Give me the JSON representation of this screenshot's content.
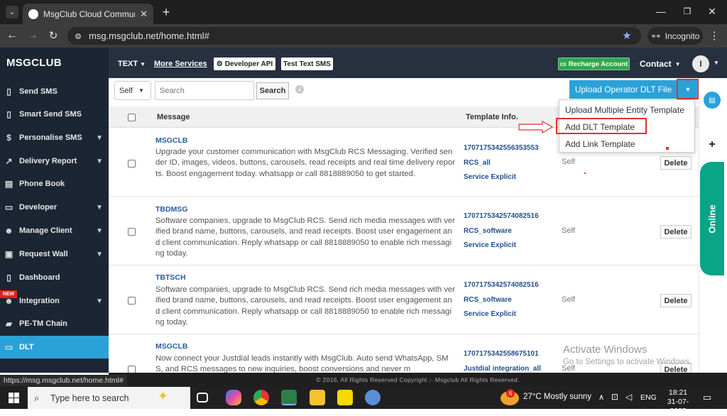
{
  "browser": {
    "tab_title": "MsgClub Cloud Communicatio",
    "url": "msg.msgclub.net/home.html#",
    "incognito_label": "Incognito",
    "status_url": "https://msg.msgclub.net/home.html#"
  },
  "header": {
    "brand": "MSGCLUB",
    "text_menu": "TEXT",
    "more_services": "More Services",
    "developer_api": "Developer API",
    "test_text_sms": "Test Text SMS",
    "recharge": "Recharge Account",
    "contact": "Contact",
    "avatar_initial": "I"
  },
  "sidebar": {
    "items": [
      {
        "label": "Send SMS",
        "icon": "phone-icon"
      },
      {
        "label": "Smart Send SMS",
        "icon": "phone-icon"
      },
      {
        "label": "Personalise SMS",
        "icon": "dollar-icon"
      },
      {
        "label": "Delivery Report",
        "icon": "chart-icon"
      },
      {
        "label": "Phone Book",
        "icon": "book-icon"
      },
      {
        "label": "Developer",
        "icon": "monitor-icon"
      },
      {
        "label": "Manage Client",
        "icon": "users-icon"
      },
      {
        "label": "Request Wall",
        "icon": "wall-icon"
      },
      {
        "label": "Dashboard",
        "icon": "file-icon"
      },
      {
        "label": "Integration",
        "icon": "users-icon"
      },
      {
        "label": "PE-TM Chain",
        "icon": "image-icon"
      },
      {
        "label": "DLT",
        "icon": "card-icon"
      }
    ],
    "new_badge": "NEW"
  },
  "toolbar": {
    "filter_value": "Self",
    "search_placeholder": "Search",
    "search_button": "Search",
    "upload_button": "Upload Operator DLT File"
  },
  "dropdown": {
    "items": [
      "Upload Multiple Entity Template",
      "Add DLT Template",
      "Add Link Template"
    ]
  },
  "table": {
    "headers": {
      "message": "Message",
      "template_info": "Template Info."
    },
    "rows": [
      {
        "sender": "MSGCLB",
        "message": "Upgrade your customer communication with MsgClub RCS Messaging. Verified sender ID, images, videos, buttons, carousels, read receipts and real time delivery reports. Boost engagement today. whatsapp or call 8818889050 to get started.",
        "template_id": "1707175342556353553",
        "template_name": "RCS_all",
        "category": "Service Explicit",
        "type": "Self",
        "delete": "Delete"
      },
      {
        "sender": "TBDMSG",
        "message": "Software companies, upgrade to MsgClub RCS. Send rich media messages with verified brand name, buttons, carousels, and read receipts. Boost user engagement and client communication. Reply whatsapp or call 8818889050 to enable rich messaging today.",
        "template_id": "1707175342574082516",
        "template_name": "RCS_software",
        "category": "Service Explicit",
        "type": "Self",
        "delete": "Delete"
      },
      {
        "sender": "TBTSCH",
        "message": "Software companies, upgrade to MsgClub RCS. Send rich media messages with verified brand name, buttons, carousels, and read receipts. Boost user engagement and client communication. Reply whatsapp or call 8818889050 to enable rich messaging today.",
        "template_id": "1707175342574082516",
        "template_name": "RCS_software",
        "category": "Service Explicit",
        "type": "Self",
        "delete": "Delete"
      },
      {
        "sender": "MSGCLB",
        "message": "Now connect your Justdial leads instantly with MsgClub. Auto send WhatsApp, SMS, and RCS messages to new inquiries, boost conversions and never m",
        "template_id": "1707175342558675101",
        "template_name": "Justdial integration_all",
        "category": "",
        "type": "Self",
        "delete": "Delete"
      }
    ]
  },
  "rail": {
    "online_label": "Online"
  },
  "footer": {
    "copyright": "© 2016, All Rights Reserved Copyright :- Msgclub All Rights Reserved."
  },
  "watermark": {
    "line1": "Activate Windows",
    "line2": "Go to Settings to activate Windows."
  },
  "taskbar": {
    "search_placeholder": "Type here to search",
    "weather": "27°C  Mostly sunny",
    "language": "ENG",
    "time": "18:21",
    "date": "31-07-2025",
    "notification_count": "6"
  },
  "colors": {
    "accent": "#2aa2d8",
    "sidebar_bg": "#1c2533",
    "header_bg": "#26303f",
    "recharge_green": "#2fa84f",
    "online_green": "#0aa486",
    "highlight_red": "#e0312d"
  }
}
